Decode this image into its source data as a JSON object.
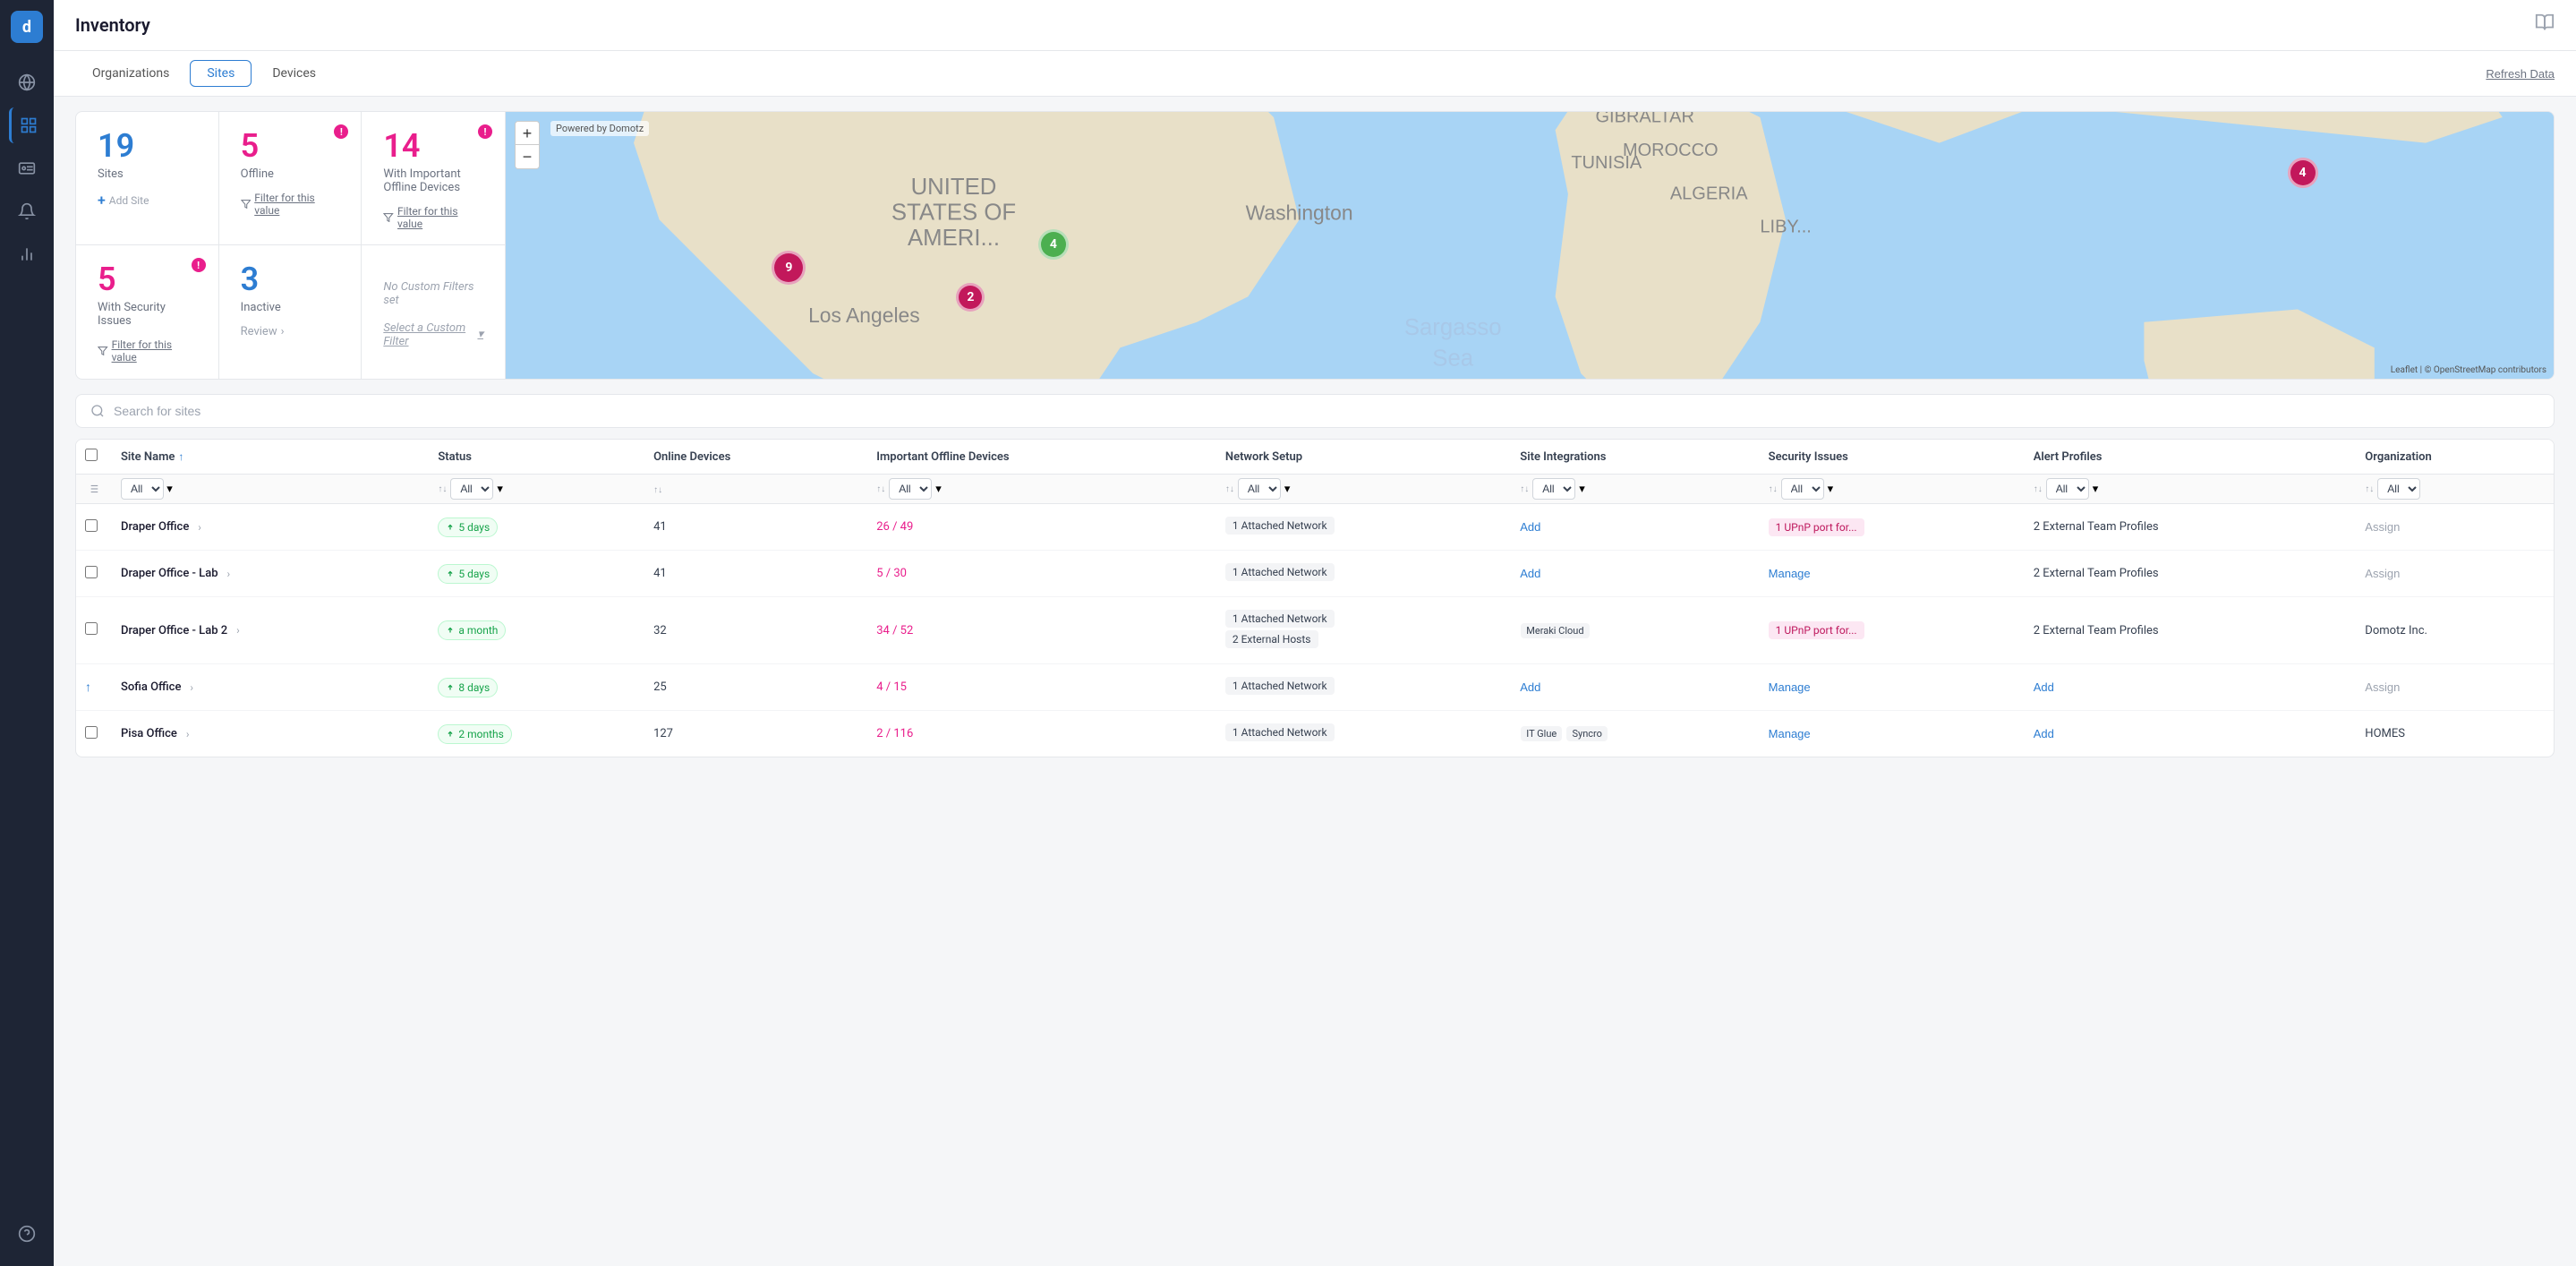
{
  "sidebar": {
    "logo": "d",
    "icons": [
      {
        "name": "globe-icon",
        "symbol": "🌐",
        "active": false
      },
      {
        "name": "grid-icon",
        "symbol": "⊞",
        "active": true
      },
      {
        "name": "id-card-icon",
        "symbol": "🪪",
        "active": false
      },
      {
        "name": "bell-icon",
        "symbol": "🔔",
        "active": false
      },
      {
        "name": "chart-icon",
        "symbol": "📊",
        "active": false
      },
      {
        "name": "support-icon",
        "symbol": "💬",
        "active": false
      }
    ]
  },
  "header": {
    "title": "Inventory",
    "book_icon": "📖"
  },
  "tabs": {
    "items": [
      {
        "label": "Organizations",
        "active": false
      },
      {
        "label": "Sites",
        "active": true
      },
      {
        "label": "Devices",
        "active": false
      }
    ],
    "refresh_label": "Refresh Data"
  },
  "stats": {
    "sites": {
      "number": "19",
      "label": "Sites",
      "color": "blue",
      "action": "Add Site"
    },
    "offline": {
      "number": "5",
      "label": "Offline",
      "color": "pink",
      "has_warning": true,
      "filter": "Filter for this value"
    },
    "important_offline": {
      "number": "14",
      "label": "With Important Offline Devices",
      "color": "pink",
      "has_warning": true,
      "filter": "Filter for this value"
    },
    "security": {
      "number": "5",
      "label": "With Security Issues",
      "color": "pink",
      "has_warning": true,
      "filter": "Filter for this value"
    },
    "inactive": {
      "number": "3",
      "label": "Inactive",
      "color": "blue",
      "review": "Review"
    },
    "custom": {
      "no_filter_text": "No Custom Filters set",
      "select_label": "Select a Custom Filter"
    }
  },
  "map": {
    "powered_by": "Powered by Domotz",
    "attribution": "Leaflet | © OpenStreetMap contributors",
    "clusters": [
      {
        "id": "c1",
        "count": 9,
        "color": "pink",
        "top": "55%",
        "left": "13%"
      },
      {
        "id": "c2",
        "count": 2,
        "color": "pink",
        "top": "68%",
        "left": "22%"
      },
      {
        "id": "c3",
        "count": 4,
        "color": "green",
        "top": "47%",
        "left": "27%"
      },
      {
        "id": "c4",
        "count": 4,
        "color": "pink",
        "top": "20%",
        "left": "89%"
      }
    ]
  },
  "search": {
    "placeholder": "Search for sites"
  },
  "table": {
    "columns": [
      {
        "label": "Site Name",
        "key": "site_name"
      },
      {
        "label": "Status",
        "key": "status"
      },
      {
        "label": "Online Devices",
        "key": "online_devices"
      },
      {
        "label": "Important Offline Devices",
        "key": "important_offline"
      },
      {
        "label": "Network Setup",
        "key": "network_setup"
      },
      {
        "label": "Site Integrations",
        "key": "integrations"
      },
      {
        "label": "Security Issues",
        "key": "security"
      },
      {
        "label": "Alert Profiles",
        "key": "alert_profiles"
      },
      {
        "label": "Organization",
        "key": "organization"
      }
    ],
    "filter_options": [
      "All"
    ],
    "rows": [
      {
        "name": "Draper Office",
        "status": "5 days",
        "online": "41",
        "offline_fraction": "26 / 49",
        "network": [
          "1 Attached Network"
        ],
        "integrations": [
          "Add"
        ],
        "security": "1 UPnP port for...",
        "alert_profiles": "2 External Team Profiles",
        "organization": "",
        "org_action": "Assign",
        "sort_indicator": ""
      },
      {
        "name": "Draper Office - Lab",
        "status": "5 days",
        "online": "41",
        "offline_fraction": "5 / 30",
        "network": [
          "1 Attached Network"
        ],
        "integrations": [
          "Add"
        ],
        "security": "Manage",
        "alert_profiles": "2 External Team Profiles",
        "organization": "",
        "org_action": "Assign",
        "sort_indicator": ""
      },
      {
        "name": "Draper Office - Lab 2",
        "status": "a month",
        "online": "32",
        "offline_fraction": "34 / 52",
        "network": [
          "1 Attached Network",
          "2 External Hosts"
        ],
        "integrations": [
          "Meraki Cloud"
        ],
        "security": "1 UPnP port for...",
        "alert_profiles": "2 External Team Profiles",
        "organization": "Domotz Inc.",
        "org_action": "",
        "sort_indicator": ""
      },
      {
        "name": "Sofia Office",
        "status": "8 days",
        "online": "25",
        "offline_fraction": "4 / 15",
        "network": [
          "1 Attached Network"
        ],
        "integrations": [
          "Add"
        ],
        "security": "Manage",
        "alert_profiles": "Add",
        "organization": "",
        "org_action": "Assign",
        "sort_indicator": "up"
      },
      {
        "name": "Pisa Office",
        "status": "2 months",
        "online": "127",
        "offline_fraction": "2 / 116",
        "network": [
          "1 Attached Network"
        ],
        "integrations": [
          "IT Glue",
          "Syncro"
        ],
        "security": "Manage",
        "alert_profiles": "Add",
        "organization": "HOMES",
        "org_action": "",
        "sort_indicator": ""
      }
    ]
  },
  "colors": {
    "blue": "#2d7dd2",
    "pink": "#e91e8c",
    "green": "#16a34a",
    "pink_cluster": "#c2185b",
    "green_cluster": "#4caf50"
  }
}
